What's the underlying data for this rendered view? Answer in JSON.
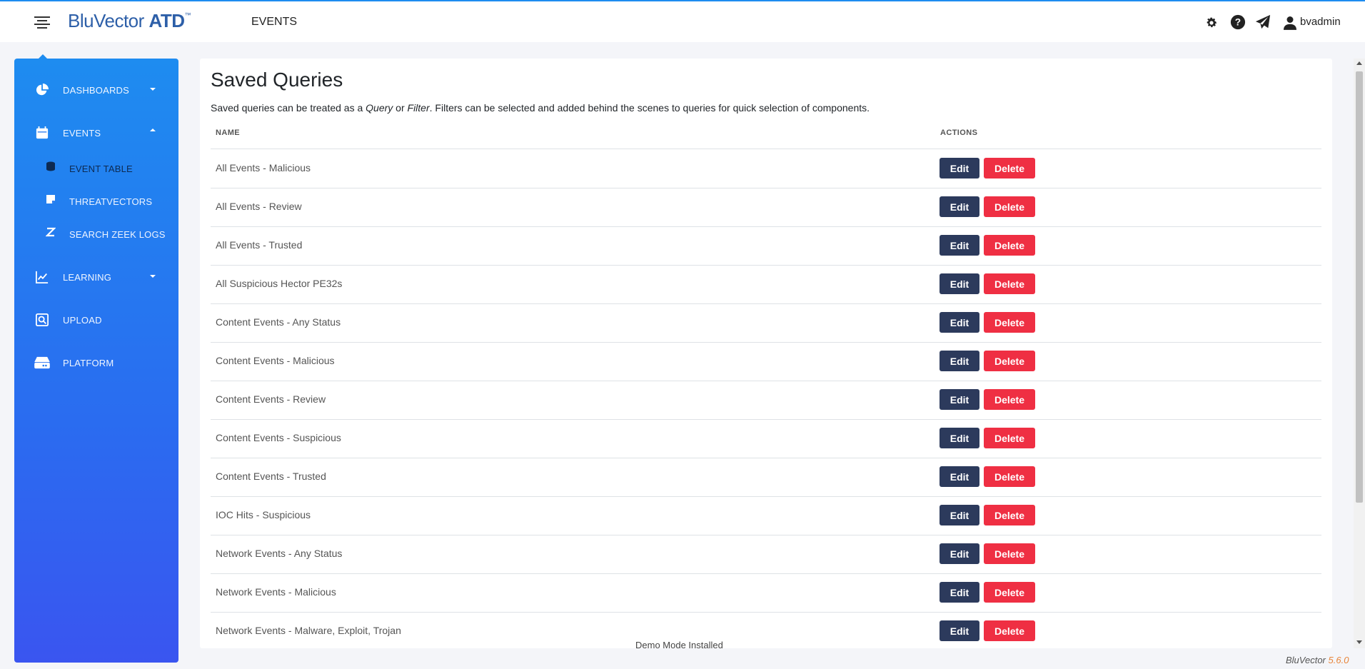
{
  "header": {
    "logo_main": "BluVector",
    "logo_bold": "ATD",
    "logo_tm": "™",
    "section": "EVENTS",
    "icons": [
      "gear-icon",
      "help-icon",
      "send-icon",
      "user-icon"
    ],
    "username": "bvadmin"
  },
  "sidebar": {
    "items": [
      {
        "label": "DASHBOARDS",
        "icon": "pie-chart-icon",
        "expanded": false
      },
      {
        "label": "EVENTS",
        "icon": "calendar-icon",
        "expanded": true
      },
      {
        "label": "LEARNING",
        "icon": "line-chart-icon",
        "expanded": false
      },
      {
        "label": "UPLOAD",
        "icon": "upload-search-icon"
      },
      {
        "label": "PLATFORM",
        "icon": "server-icon"
      }
    ],
    "subitems": [
      {
        "label": "EVENT TABLE",
        "icon": "database-icon",
        "active": true
      },
      {
        "label": "THREATVECTORS",
        "icon": "note-icon"
      },
      {
        "label": "SEARCH ZEEK LOGS",
        "icon": "zeek-icon"
      }
    ]
  },
  "main": {
    "title": "Saved Queries",
    "description": {
      "pre": "Saved queries can be treated as a ",
      "query": "Query",
      "mid": " or ",
      "filter": "Filter",
      "post": ". Filters can be selected and added behind the scenes to queries for quick selection of components."
    },
    "columns": {
      "name": "NAME",
      "actions": "ACTIONS"
    },
    "edit_label": "Edit",
    "delete_label": "Delete",
    "rows": [
      "All Events - Malicious",
      "All Events - Review",
      "All Events - Trusted",
      "All Suspicious Hector PE32s",
      "Content Events - Any Status",
      "Content Events - Malicious",
      "Content Events - Review",
      "Content Events - Suspicious",
      "Content Events - Trusted",
      "IOC Hits - Suspicious",
      "Network Events - Any Status",
      "Network Events - Malicious",
      "Network Events - Malware, Exploit, Trojan"
    ]
  },
  "status": {
    "demo": "Demo Mode Installed",
    "brand": "BluVector",
    "version": "5.6.0"
  },
  "colors": {
    "accent": "#1e8cf0",
    "edit_button": "#2c3a5c",
    "delete_button": "#ef2f43",
    "version": "#e8853a"
  }
}
